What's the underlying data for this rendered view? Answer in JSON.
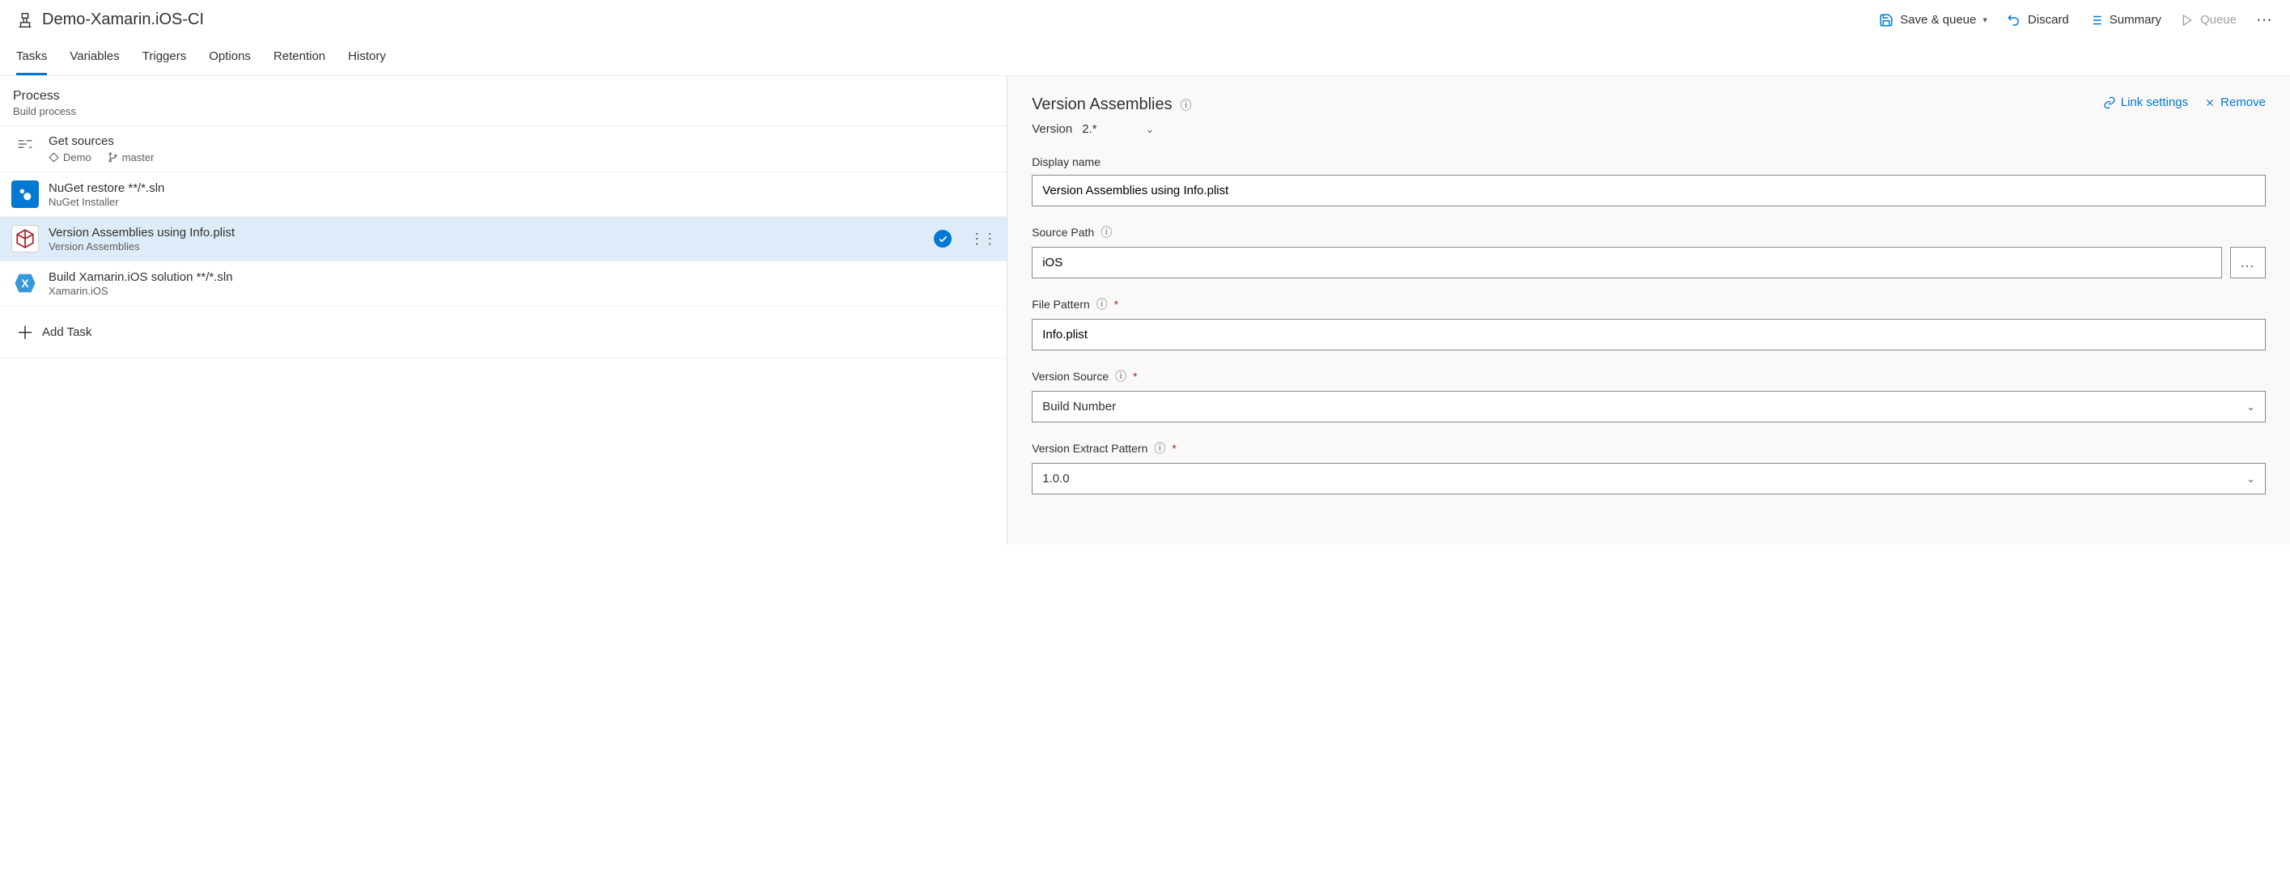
{
  "header": {
    "title": "Demo-Xamarin.iOS-CI",
    "toolbar": {
      "save_queue": "Save & queue",
      "discard": "Discard",
      "summary": "Summary",
      "queue": "Queue"
    }
  },
  "tabs": [
    "Tasks",
    "Variables",
    "Triggers",
    "Options",
    "Retention",
    "History"
  ],
  "active_tab": "Tasks",
  "process": {
    "title": "Process",
    "subtitle": "Build process"
  },
  "get_sources": {
    "title": "Get sources",
    "repo": "Demo",
    "branch": "master"
  },
  "tasks": [
    {
      "title": "NuGet restore **/*.sln",
      "sub": "NuGet Installer",
      "icon": "nuget"
    },
    {
      "title": "Version Assemblies using Info.plist",
      "sub": "Version Assemblies",
      "icon": "version",
      "selected": true,
      "checked": true
    },
    {
      "title": "Build Xamarin.iOS solution **/*.sln",
      "sub": "Xamarin.iOS",
      "icon": "xamarin"
    }
  ],
  "add_task_label": "Add Task",
  "details": {
    "title": "Version Assemblies",
    "link_settings": "Link settings",
    "remove": "Remove",
    "version_label": "Version",
    "version_value": "2.*",
    "fields": {
      "display_name": {
        "label": "Display name",
        "value": "Version Assemblies using Info.plist"
      },
      "source_path": {
        "label": "Source Path",
        "value": "iOS",
        "info": true,
        "browse": true
      },
      "file_pattern": {
        "label": "File Pattern",
        "value": "Info.plist",
        "info": true,
        "required": true
      },
      "version_source": {
        "label": "Version Source",
        "value": "Build Number",
        "info": true,
        "required": true,
        "select": true
      },
      "version_extract": {
        "label": "Version Extract Pattern",
        "value": "1.0.0",
        "info": true,
        "required": true,
        "select": true
      }
    }
  }
}
